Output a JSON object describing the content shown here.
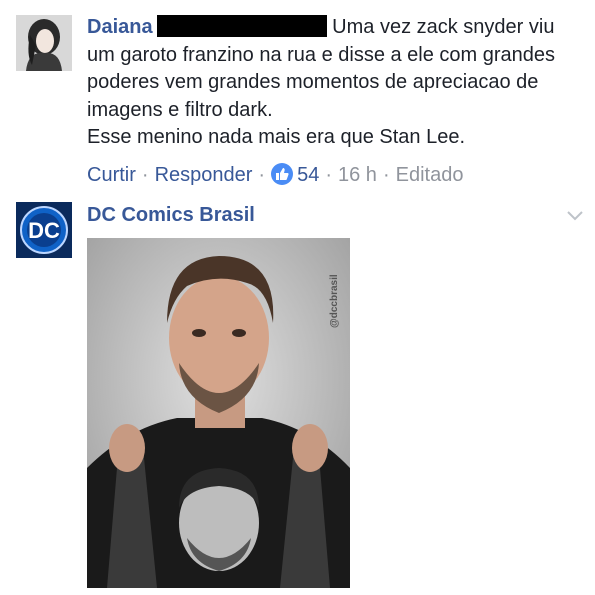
{
  "comment1": {
    "author": "Daiana",
    "text_line1": "Uma vez zack snyder viu",
    "text_rest": "um garoto franzino na rua e disse a ele com grandes poderes vem grandes momentos de apreciacao de imagens e filtro dark.",
    "text_last": "Esse menino nada mais era que Stan Lee.",
    "actions": {
      "like": "Curtir",
      "reply": "Responder",
      "reaction_count": "54",
      "time": "16 h",
      "edited": "Editado"
    }
  },
  "comment2": {
    "author": "DC Comics Brasil",
    "image_watermark": "@dccbrasil"
  },
  "colors": {
    "link": "#385898",
    "meta": "#90949c",
    "like": "#4a8cf5"
  },
  "icons": [
    "like-icon",
    "chevron-down-icon",
    "dc-logo"
  ]
}
